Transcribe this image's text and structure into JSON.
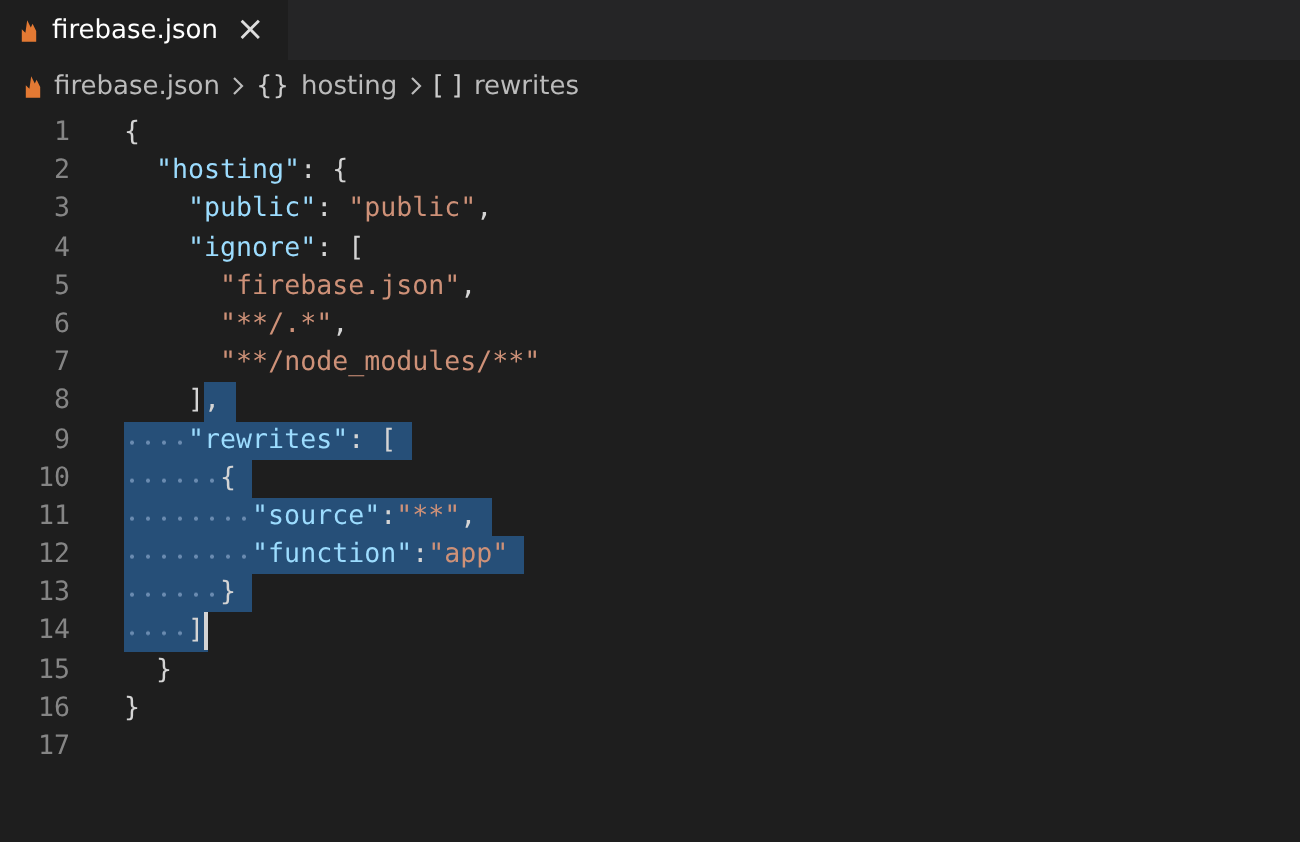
{
  "tab": {
    "label": "firebase.json",
    "close": "×",
    "selected": true
  },
  "breadcrumb": [
    {
      "kind": "file",
      "label": "firebase.json"
    },
    {
      "kind": "object",
      "symbol": "{}",
      "label": "hosting"
    },
    {
      "kind": "array",
      "symbol": "[ ]",
      "label": "rewrites"
    }
  ],
  "lines": [
    {
      "number": "1",
      "tokens": [
        {
          "kind": "punct",
          "text": "{",
          "selected": false
        }
      ]
    },
    {
      "number": "2",
      "tokens": [
        {
          "kind": "key",
          "text": "  \"hosting\"",
          "selected": false
        },
        {
          "kind": "punct",
          "text": ": {",
          "selected": false
        }
      ]
    },
    {
      "number": "3",
      "tokens": [
        {
          "kind": "key",
          "text": "    \"public\"",
          "selected": false
        },
        {
          "kind": "punct",
          "text": ": ",
          "selected": false
        },
        {
          "kind": "string",
          "text": "\"public\"",
          "selected": false
        },
        {
          "kind": "punct",
          "text": ",",
          "selected": false
        }
      ]
    },
    {
      "number": "4",
      "tokens": [
        {
          "kind": "key",
          "text": "    \"ignore\"",
          "selected": false
        },
        {
          "kind": "punct",
          "text": ": [",
          "selected": false
        }
      ]
    },
    {
      "number": "5",
      "tokens": [
        {
          "kind": "string",
          "text": "      \"firebase.json\"",
          "selected": false
        },
        {
          "kind": "punct",
          "text": ",",
          "selected": false
        }
      ]
    },
    {
      "number": "6",
      "tokens": [
        {
          "kind": "string",
          "text": "      \"**/.*\"",
          "selected": false
        },
        {
          "kind": "punct",
          "text": ",",
          "selected": false
        }
      ]
    },
    {
      "number": "7",
      "tokens": [
        {
          "kind": "string",
          "text": "      \"**/node_modules/**\"",
          "selected": false
        }
      ]
    },
    {
      "number": "8",
      "tokens": [
        {
          "kind": "punct",
          "text": "    ]",
          "selected": false
        },
        {
          "kind": "punct",
          "text": ",",
          "selected": true
        }
      ]
    },
    {
      "number": "9",
      "tokens": [
        {
          "kind": "key",
          "text": "    \"rewrites\"",
          "selected": true
        },
        {
          "kind": "punct",
          "text": ": [",
          "selected": true
        }
      ]
    },
    {
      "number": "10",
      "tokens": [
        {
          "kind": "punct",
          "text": "      {",
          "selected": true
        }
      ]
    },
    {
      "number": "11",
      "tokens": [
        {
          "kind": "key",
          "text": "        \"source\"",
          "selected": true
        },
        {
          "kind": "punct",
          "text": ":",
          "selected": true
        },
        {
          "kind": "string",
          "text": "\"**\"",
          "selected": true
        },
        {
          "kind": "punct",
          "text": ",",
          "selected": true
        }
      ]
    },
    {
      "number": "12",
      "tokens": [
        {
          "kind": "key",
          "text": "        \"function\"",
          "selected": true
        },
        {
          "kind": "punct",
          "text": ":",
          "selected": true
        },
        {
          "kind": "string",
          "text": "\"app\"",
          "selected": true
        }
      ]
    },
    {
      "number": "13",
      "tokens": [
        {
          "kind": "punct",
          "text": "      }",
          "selected": true
        }
      ]
    },
    {
      "number": "14",
      "tokens": [
        {
          "kind": "punct",
          "text": "    ]",
          "selected": true
        },
        {
          "kind": "cursor",
          "selected": true
        }
      ]
    },
    {
      "number": "15",
      "tokens": [
        {
          "kind": "punct",
          "text": "  }",
          "selected": false
        }
      ]
    },
    {
      "number": "16",
      "tokens": [
        {
          "kind": "punct",
          "text": "}",
          "selected": false
        }
      ]
    },
    {
      "number": "17"
    }
  ]
}
